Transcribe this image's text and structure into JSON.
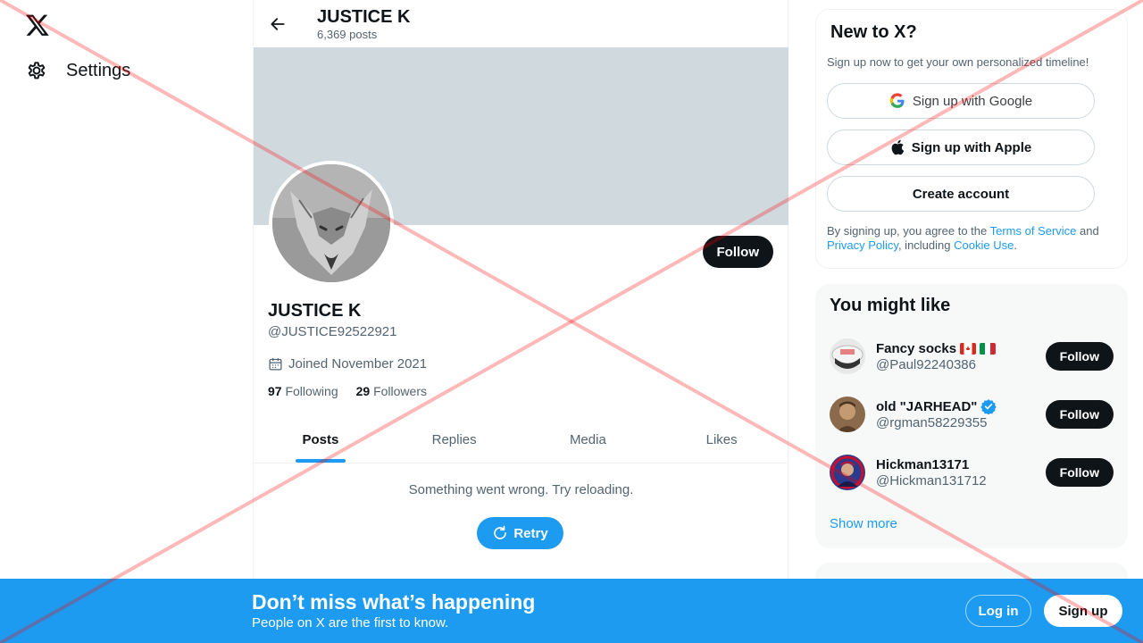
{
  "nav": {
    "logo_icon": "x-logo-icon",
    "settings_label": "Settings"
  },
  "header": {
    "title": "JUSTICE K",
    "posts_count": "6,369 posts"
  },
  "profile": {
    "name": "JUSTICE K",
    "handle": "@JUSTICE92522921",
    "joined": "Joined November 2021",
    "following_count": "97",
    "following_label": "Following",
    "followers_count": "29",
    "followers_label": "Followers",
    "follow_label": "Follow"
  },
  "tabs": [
    {
      "label": "Posts",
      "active": true
    },
    {
      "label": "Replies",
      "active": false
    },
    {
      "label": "Media",
      "active": false
    },
    {
      "label": "Likes",
      "active": false
    }
  ],
  "feed": {
    "error": "Something went wrong. Try reloading.",
    "retry_label": "Retry"
  },
  "signup": {
    "title": "New to X?",
    "subtitle": "Sign up now to get your own personalized timeline!",
    "google_label": "Sign up with Google",
    "apple_label": "Sign up with Apple",
    "create_label": "Create account",
    "legal_prefix": "By signing up, you agree to the ",
    "terms": "Terms of Service",
    "and": " and ",
    "privacy": "Privacy Policy",
    "including": ", including ",
    "cookie": "Cookie Use",
    "period": "."
  },
  "you_might_like": {
    "title": "You might like",
    "items": [
      {
        "name": "Fancy socks",
        "handle": "@Paul92240386",
        "follow": "Follow"
      },
      {
        "name": "old \"JARHEAD\"",
        "handle": "@rgman58229355",
        "follow": "Follow"
      },
      {
        "name": "Hickman13171",
        "handle": "@Hickman131712",
        "follow": "Follow"
      }
    ],
    "show_more": "Show more"
  },
  "bottom_bar": {
    "title": "Don’t miss what’s happening",
    "subtitle": "People on X are the first to know.",
    "login": "Log in",
    "signup": "Sign up"
  },
  "colors": {
    "accent": "#1d9bf0",
    "dark": "#0f1419",
    "muted": "#536471",
    "banner": "#cfd9de"
  }
}
